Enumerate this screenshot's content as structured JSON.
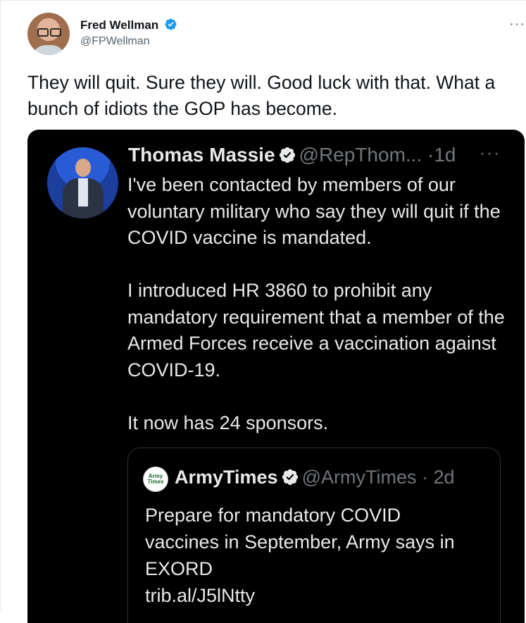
{
  "tweet": {
    "display_name": "Fred Wellman",
    "handle": "@FPWellman",
    "more": "···",
    "text": "They will quit. Sure they will. Good luck with that. What a bunch of idiots the GOP has become."
  },
  "quoted": {
    "display_name": "Thomas Massie",
    "handle_time": "@RepThom... ·1d",
    "more": "···",
    "paragraphs": [
      "I've been contacted by members of our voluntary military who say they will quit if the COVID vaccine is mandated.",
      "I introduced HR 3860 to prohibit any mandatory requirement that a member of the Armed Forces receive a vaccination against COVID-19.",
      "It now has 24 sponsors."
    ],
    "inner": {
      "logo_text": "Army Times",
      "display_name": "ArmyTimes",
      "handle_time": "@ArmyTimes · 2d",
      "lines": [
        "Prepare for mandatory COVID",
        "vaccines in September, Army says in",
        "EXORD",
        "trib.al/J5lNtty"
      ]
    }
  },
  "colors": {
    "verified_blue": "#1d9bf0",
    "embed_bg": "#000000",
    "text_light": "#e7e9ea",
    "text_muted": "#71767b"
  }
}
